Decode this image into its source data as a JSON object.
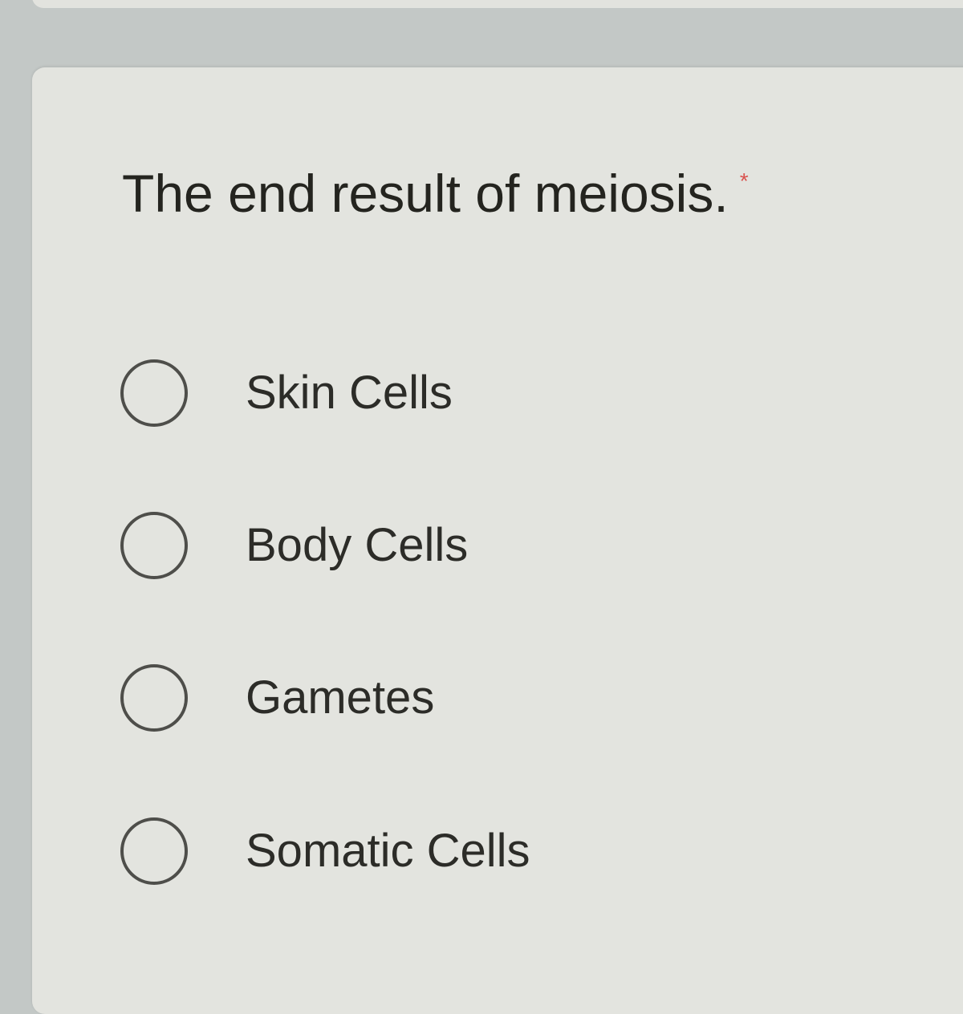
{
  "question": {
    "title": "The end result of meiosis.",
    "required_mark": "*",
    "options": [
      {
        "label": "Skin Cells",
        "selected": false
      },
      {
        "label": "Body Cells",
        "selected": false
      },
      {
        "label": "Gametes",
        "selected": false
      },
      {
        "label": "Somatic Cells",
        "selected": false
      }
    ]
  },
  "colors": {
    "background": "#c3c8c6",
    "card": "#e3e4df",
    "text": "#24241f",
    "required": "#d9534f",
    "radio_border": "#4e4e4a"
  }
}
